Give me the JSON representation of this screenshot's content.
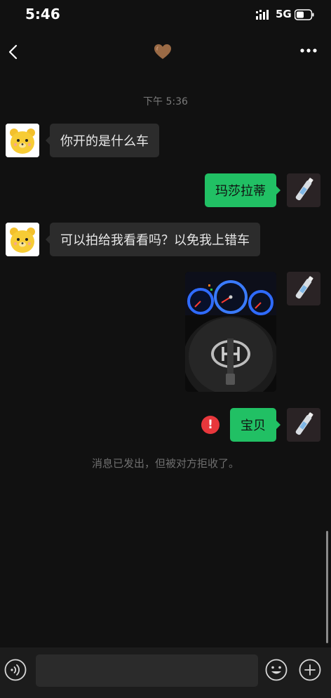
{
  "status_bar": {
    "time": "5:46",
    "network": "5G",
    "signal_icon": "signal-bars-icon",
    "battery_icon": "battery-icon"
  },
  "nav": {
    "back_icon": "chevron-left-icon",
    "title_icon": "brown-heart-icon",
    "more_icon": "more-dots-icon"
  },
  "chat": {
    "timestamp": "下午 5:36",
    "messages": [
      {
        "side": "left",
        "type": "text",
        "text": "你开的是什么车",
        "avatar": "yellow-bear-avatar"
      },
      {
        "side": "right",
        "type": "text",
        "text": "玛莎拉蒂",
        "avatar": "user-avatar"
      },
      {
        "side": "left",
        "type": "text",
        "text": "可以拍给我看看吗？以免我上错车",
        "avatar": "yellow-bear-avatar"
      },
      {
        "side": "right",
        "type": "image",
        "description": "steering-wheel-dashboard-photo",
        "avatar": "user-avatar"
      },
      {
        "side": "right",
        "type": "text",
        "text": "宝贝",
        "avatar": "user-avatar",
        "status": "failed"
      }
    ],
    "system_notice": "消息已发出，但被对方拒收了。"
  },
  "input_bar": {
    "voice_icon": "voice-icon",
    "placeholder": "",
    "emoji_icon": "emoji-icon",
    "add_icon": "plus-icon"
  },
  "colors": {
    "background": "#111111",
    "bubble_left": "#2c2c2c",
    "bubble_right": "#21c064",
    "error": "#e8373c"
  }
}
